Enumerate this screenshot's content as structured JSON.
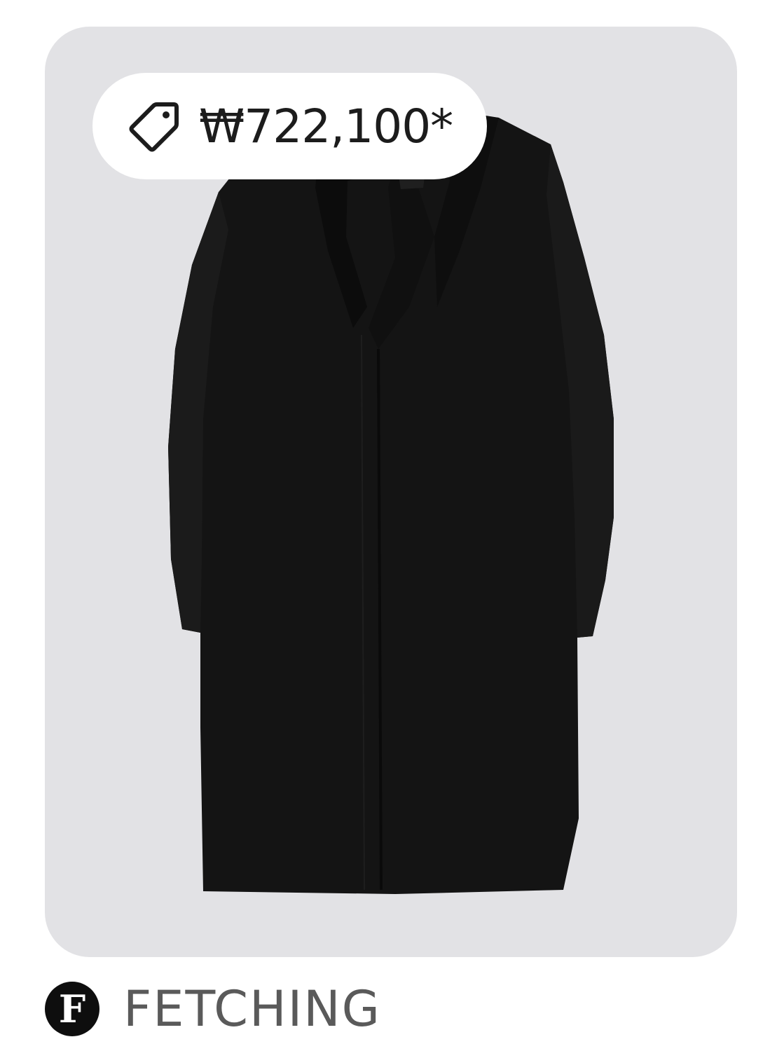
{
  "product": {
    "image_alt": "black coat",
    "background_color": "#e2e2e5"
  },
  "price_badge": {
    "icon": "price-tag-icon",
    "price": "₩722,100*"
  },
  "merchant": {
    "logo_letter": "F",
    "name": "FETCHING"
  }
}
